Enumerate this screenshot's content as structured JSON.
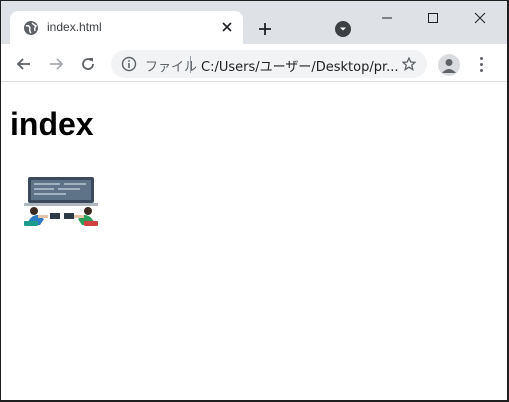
{
  "browser": {
    "tab": {
      "title": "index.html"
    },
    "address": {
      "scheme_label": "ファイル",
      "url": "C:/Users/ユーザー/Desktop/pr..."
    }
  },
  "page": {
    "heading": "index",
    "image": {
      "semantic": "illustration of people working at computers"
    }
  },
  "icons": {
    "favicon": "globe-icon",
    "close": "close-icon",
    "new_tab": "plus-icon",
    "tab_search": "tab-search-icon",
    "minimize": "minimize-icon",
    "maximize": "maximize-icon",
    "window_close": "close-icon",
    "back": "arrow-left-icon",
    "forward": "arrow-right-icon",
    "reload": "reload-icon",
    "info": "info-icon",
    "bookmark": "star-icon",
    "profile": "avatar-icon",
    "menu": "kebab-menu-icon"
  },
  "colors": {
    "tabstrip": "#dee1e6",
    "omnibox": "#f1f3f4",
    "icon": "#5f6368"
  }
}
